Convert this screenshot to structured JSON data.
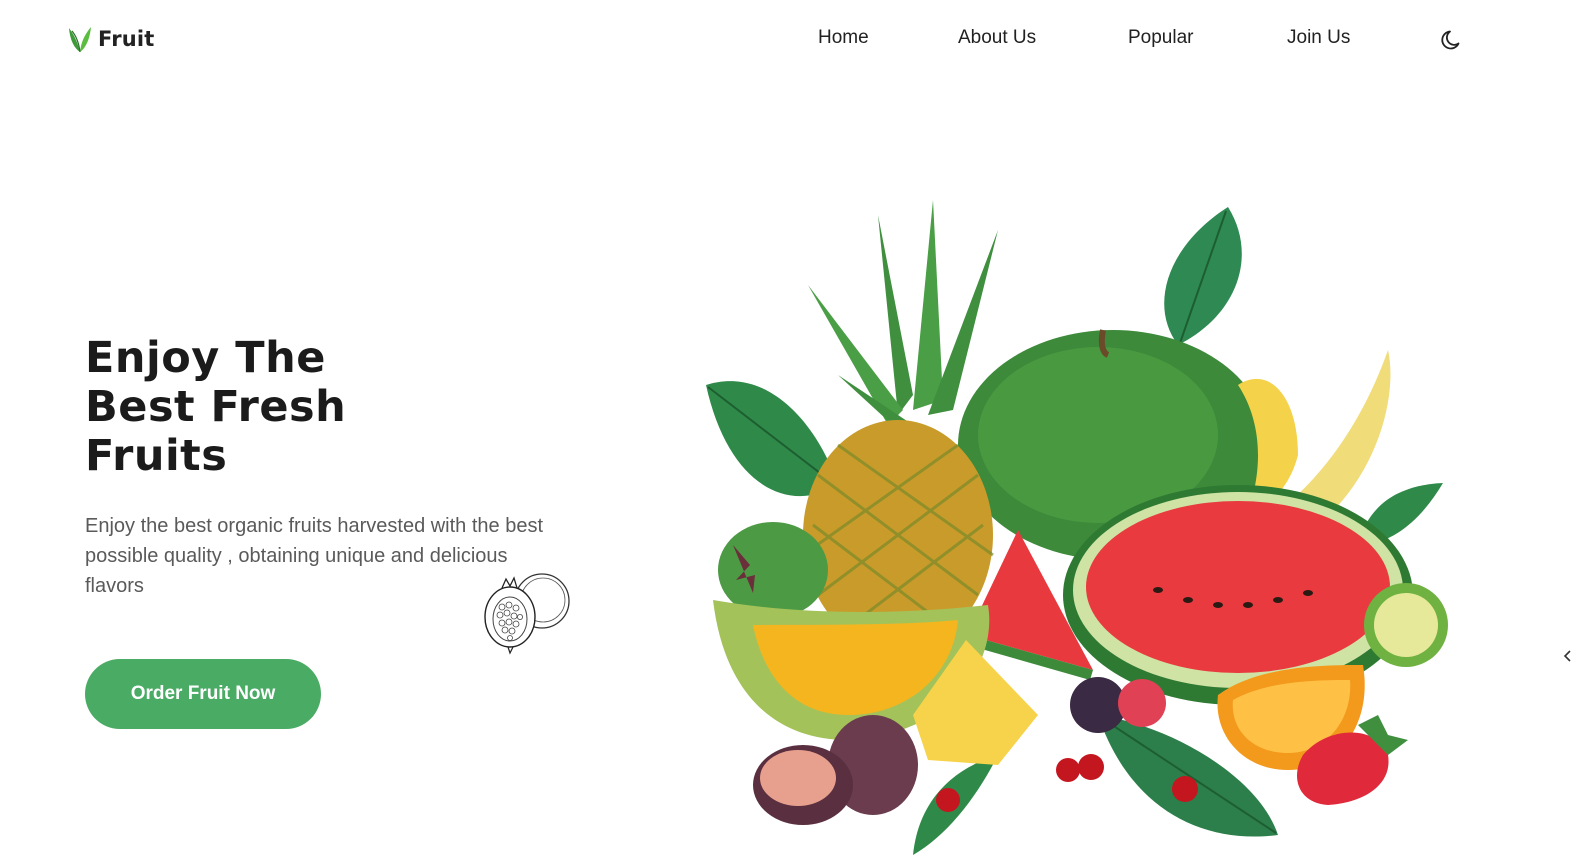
{
  "header": {
    "logo_text": "Fruit",
    "logo_icon": "leaf-icon",
    "nav": [
      {
        "label": "Home"
      },
      {
        "label": "About Us"
      },
      {
        "label": "Popular"
      },
      {
        "label": "Join Us"
      }
    ],
    "theme_icon": "moon-icon"
  },
  "hero": {
    "title_lines": [
      "Enjoy The",
      "Best Fresh",
      "Fruits"
    ],
    "description": "Enjoy the best organic fruits harvested with the best possible quality , obtaining unique and delicious flavors",
    "cta_label": "Order Fruit Now",
    "decor_icon": "pomegranate-sketch-icon",
    "image_icon": "fruit-arrangement-illustration"
  },
  "colors": {
    "accent": "#4aab65",
    "text": "#1b1b1b",
    "muted": "#5a5a5a",
    "background": "#ffffff"
  }
}
